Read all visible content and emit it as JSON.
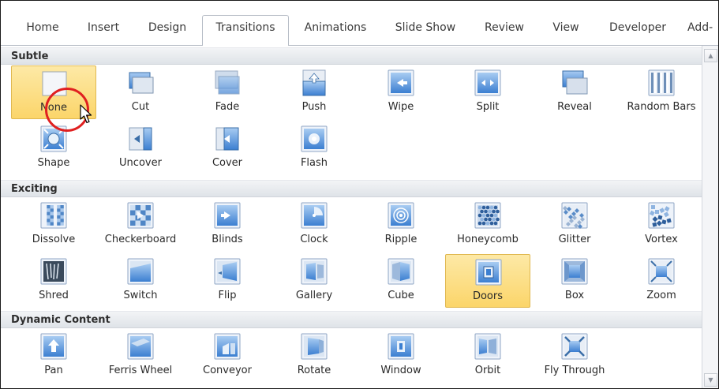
{
  "ribbon": {
    "tabs": [
      "Home",
      "Insert",
      "Design",
      "Transitions",
      "Animations",
      "Slide Show",
      "Review",
      "View",
      "Developer",
      "Add-"
    ],
    "active": "Transitions"
  },
  "gallery": {
    "sections": [
      {
        "title": "Subtle",
        "items": [
          "None",
          "Cut",
          "Fade",
          "Push",
          "Wipe",
          "Split",
          "Reveal",
          "Random Bars",
          "Shape",
          "Uncover",
          "Cover",
          "Flash"
        ]
      },
      {
        "title": "Exciting",
        "items": [
          "Dissolve",
          "Checkerboard",
          "Blinds",
          "Clock",
          "Ripple",
          "Honeycomb",
          "Glitter",
          "Vortex",
          "Shred",
          "Switch",
          "Flip",
          "Gallery",
          "Cube",
          "Doors",
          "Box",
          "Zoom"
        ]
      },
      {
        "title": "Dynamic Content",
        "items": [
          "Pan",
          "Ferris Wheel",
          "Conveyor",
          "Rotate",
          "Window",
          "Orbit",
          "Fly Through"
        ]
      }
    ],
    "hover_item": "None",
    "selected_item": "Doors"
  },
  "colors": {
    "highlight": "#fbd56a",
    "marker": "#e02020",
    "icon_blue": "#3c7fd1"
  }
}
